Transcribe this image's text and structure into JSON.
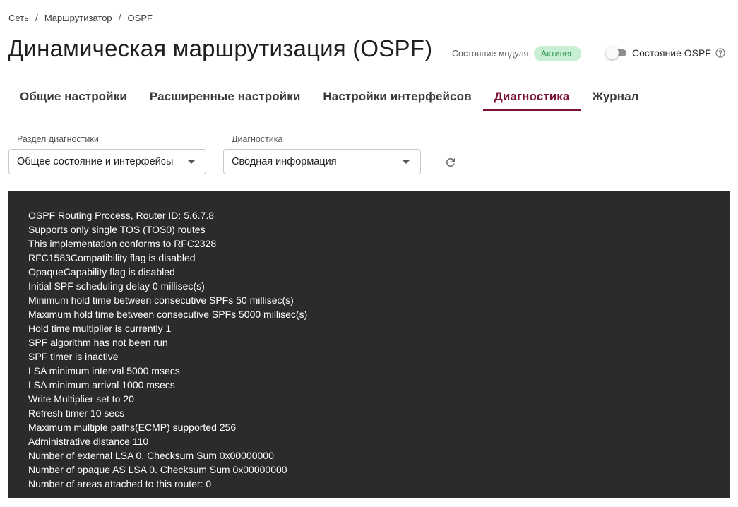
{
  "breadcrumb": {
    "items": [
      "Сеть",
      "Маршрутизатор",
      "OSPF"
    ],
    "separator": "/"
  },
  "page": {
    "title": "Динамическая маршрутизация (OSPF)"
  },
  "module_state": {
    "label": "Состояние модуля:",
    "badge": "Активен",
    "badge_color": "#2f9a52"
  },
  "ospf_state": {
    "label": "Состояние OSPF",
    "enabled": false,
    "help_icon": "question-circle-icon"
  },
  "tabs": [
    {
      "label": "Общие настройки",
      "active": false
    },
    {
      "label": "Расширенные настройки",
      "active": false
    },
    {
      "label": "Настройки интерфейсов",
      "active": false
    },
    {
      "label": "Диагностика",
      "active": true
    },
    {
      "label": "Журнал",
      "active": false
    }
  ],
  "accent_color": "#7a1231",
  "filters": {
    "section": {
      "label": "Раздел диагностики",
      "value": "Общее состояние и интерфейсы"
    },
    "diagnostic": {
      "label": "Диагностика",
      "value": "Сводная информация"
    },
    "refresh_icon": "refresh-icon"
  },
  "console": {
    "lines": [
      "OSPF Routing Process, Router ID: 5.6.7.8",
      "Supports only single TOS (TOS0) routes",
      "This implementation conforms to RFC2328",
      "RFC1583Compatibility flag is disabled",
      "OpaqueCapability flag is disabled",
      "Initial SPF scheduling delay 0 millisec(s)",
      "Minimum hold time between consecutive SPFs 50 millisec(s)",
      "Maximum hold time between consecutive SPFs 5000 millisec(s)",
      "Hold time multiplier is currently 1",
      "SPF algorithm has not been run",
      "SPF timer is inactive",
      "LSA minimum interval 5000 msecs",
      "LSA minimum arrival 1000 msecs",
      "Write Multiplier set to 20",
      "Refresh timer 10 secs",
      "Maximum multiple paths(ECMP) supported 256",
      "Administrative distance 110",
      "Number of external LSA 0. Checksum Sum 0x00000000",
      "Number of opaque AS LSA 0. Checksum Sum 0x00000000",
      "Number of areas attached to this router: 0"
    ]
  }
}
